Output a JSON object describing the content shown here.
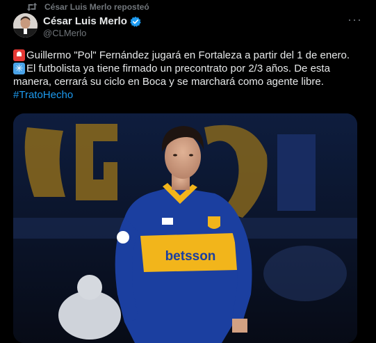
{
  "repost": {
    "text": "César Luis Merlo reposteó",
    "icon": "repost-icon"
  },
  "author": {
    "name": "César Luis Merlo",
    "handle": "@CLMerlo",
    "verified_color": "#1d9bf0"
  },
  "tweet": {
    "line1": "Guillermo \"Pol\" Fernández jugará en Fortaleza a partir del 1 de enero.",
    "line2": "El futbolista ya tiene firmado un precontrato por 2/3 años. De esta",
    "line3": "manera, cerrará su ciclo en Boca y se marchará como agente libre.",
    "hashtag": "#TratoHecho",
    "emoji1": "police-siren-icon",
    "emoji2": "sparkle-icon"
  },
  "media": {
    "description_icon": "player-photo",
    "sponsor": "betsson",
    "kit_colors": {
      "primary": "#1b3fa0",
      "secondary": "#f2b51b"
    }
  },
  "colors": {
    "background": "#000000",
    "text": "#e7e9ea",
    "muted": "#71767b",
    "link": "#1d9bf0"
  }
}
